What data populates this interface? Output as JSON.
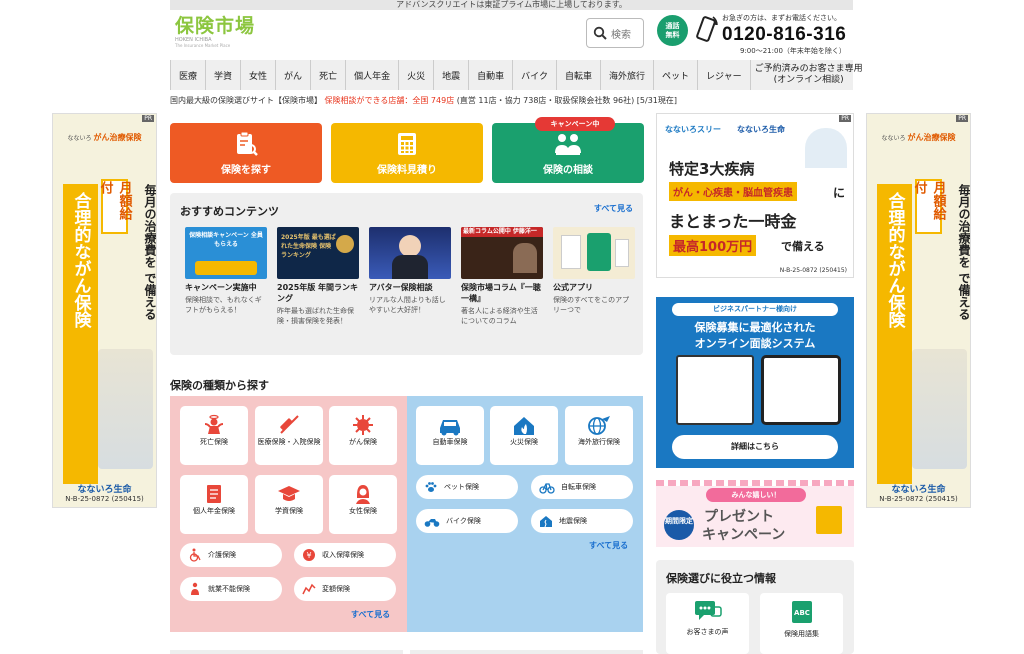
{
  "topbar": {
    "text": "アドバンスクリエイトは東証プライム市場に上場しております。"
  },
  "logo": {
    "jp": "保険市場",
    "en": "HOKEN ICHIBA",
    "sub": "The Insurance Market Place"
  },
  "search": {
    "label": "検索"
  },
  "call": {
    "badge_line1": "通話",
    "badge_line2": "無料",
    "note": "お急ぎの方は、まずお電話ください。",
    "number": "0120-816-316",
    "hours": "9:00～21:00（年末年始を除く）"
  },
  "nav": {
    "items": [
      "医療",
      "学資",
      "女性",
      "がん",
      "死亡",
      "個人年金",
      "火災",
      "地震",
      "自動車",
      "バイク",
      "自転車",
      "海外旅行",
      "ペット",
      "レジャー"
    ],
    "reserve_line1": "ご予約済みのお客さま専用",
    "reserve_line2": "(オンライン相談)"
  },
  "info": {
    "text1": "国内最大級の保険選びサイト【保険市場】",
    "text2": "保険相談ができる店舗：全国 749店",
    "text3": "(直営 11店・協力 738店・取扱保険会社数 96社) [5/31現在]"
  },
  "pr_left": {
    "tag": "PR",
    "brand_top": "なないろ",
    "product": "がん治療保険",
    "main": "合理的ながん保険",
    "month": "月額給付",
    "text": "毎月の治療費を で備える",
    "brand": "なないろ生命",
    "code": "N-B-25-0872 (250415)"
  },
  "pr_right_side": {
    "tag": "PR",
    "brand_top": "なないろ",
    "product": "がん治療保険",
    "main": "合理的ながん保険",
    "month": "月額給付",
    "text": "毎月の治療費を で備える",
    "brand": "なないろ生命",
    "code": "N-B-25-0872 (250415)"
  },
  "buttons": {
    "find": "保険を探す",
    "estimate": "保険料見積り",
    "consult": "保険の相談",
    "campaign_tag": "キャンペーン中",
    "color_find": "#ee5a24",
    "color_estimate": "#f5b800",
    "color_consult": "#1aa06e"
  },
  "recommend": {
    "title": "おすすめコンテンツ",
    "all": "すべて見る",
    "items": [
      {
        "thumb": "保険相談キャンペーン 全員もらえる",
        "title": "キャンペーン実施中",
        "desc": "保険相談で、もれなくギフトがもらえる！"
      },
      {
        "thumb": "2025年版 最も選ばれた生命保険 保険ランキング",
        "title": "2025年版 年間ランキング",
        "desc": "昨年最も選ばれた生命保険・損害保険を発表！"
      },
      {
        "thumb": "",
        "title": "アバター保険相談",
        "desc": "リアルな人間よりも話しやすいと大好評！"
      },
      {
        "thumb": "最新コラム公開中 伊藤洋一",
        "title": "保険市場コラム『一聴一構』",
        "desc": "著名人による経済や生活についてのコラム"
      },
      {
        "thumb": "",
        "title": "公式アプリ",
        "desc": "保険のすべてをこのアプリーつで"
      }
    ]
  },
  "types": {
    "title": "保険の種類から探す",
    "life": [
      "死亡保険",
      "医療保険・入院保険",
      "がん保険",
      "個人年金保険",
      "学資保険",
      "女性保険"
    ],
    "life_pills": [
      "介護保険",
      "収入保障保険",
      "就業不能保険",
      "変額保険"
    ],
    "general": [
      "自動車保険",
      "火災保険",
      "海外旅行保険"
    ],
    "general_pills": [
      "ペット保険",
      "自転車保険",
      "バイク保険",
      "地震保険"
    ],
    "see_all": "すべて見る"
  },
  "pr_right1": {
    "tag": "PR",
    "brand": "なないろ生命",
    "brand_small": "なないろスリー",
    "headline": "特定3大疾病",
    "diseases": "がん・心疾患・脳血管疾患",
    "ni": "に",
    "lump": "まとまった一時金",
    "max": "最高100万円",
    "prepare": "で備える",
    "code": "N-B-25-0872 (250415)"
  },
  "pr_right2": {
    "tag": "ビジネスパートナー様向け",
    "line1": "保険募集に最適化された",
    "line2": "オンライン面談システム",
    "button": "詳細はこちら"
  },
  "pr_right3": {
    "top": "みんな嬉しい！",
    "limited": "期間限定",
    "main1": "プレゼント",
    "main2": "キャンペーン"
  },
  "helpful": {
    "title": "保険選びに役立つ情報",
    "items": [
      "お客さまの声",
      "保険用語集"
    ]
  }
}
